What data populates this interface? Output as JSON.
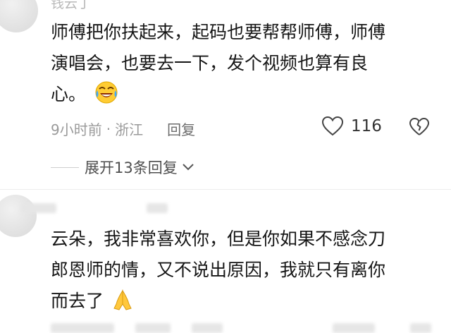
{
  "comment1": {
    "author": "钱云丁",
    "lines": [
      "师傅把你扶起来，起码也要帮帮师傅，师傅",
      "演唱会，也要去一下，发个视频也算有良",
      "心。"
    ],
    "emoji": "laughing-crying-emoji",
    "time": "9小时前",
    "separator": "·",
    "location": "浙江",
    "reply_label": "回复",
    "like_count": "116",
    "expand_label": "展开13条回复"
  },
  "comment2": {
    "lines": [
      "云朵，我非常喜欢你，但是你如果不感念刀",
      "郎恩师的情，又不说出原因，我就只有离你",
      "而去了"
    ],
    "emoji": "folded-hands-emoji"
  },
  "colors": {
    "text": "#161616",
    "meta": "#9a9a9a",
    "divider": "#ededed"
  }
}
